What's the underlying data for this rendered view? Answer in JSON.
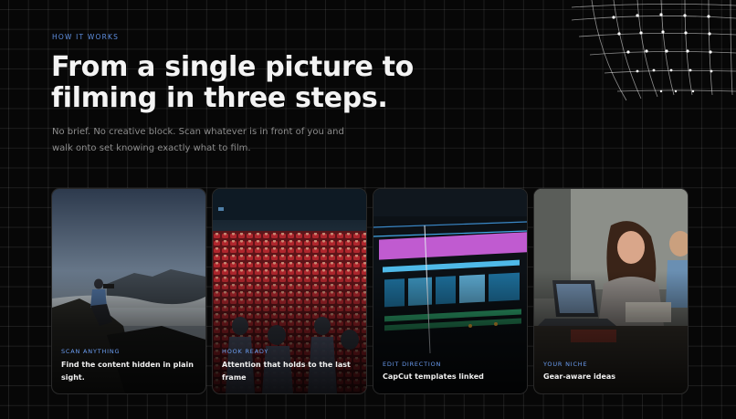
{
  "hero": {
    "eyebrow": "HOW IT WORKS",
    "headline": "From a single picture to filming in three steps.",
    "subtext": "No brief. No creative block. Scan whatever is in front of you and walk onto set knowing exactly what to film."
  },
  "cards": [
    {
      "tag": "SCAN ANYTHING",
      "title": "Find the content hidden in plain sight.",
      "image": "photographer-on-mountain"
    },
    {
      "tag": "HOOK READY",
      "title": "Attention that holds to the last frame",
      "image": "cinema-audience"
    },
    {
      "tag": "EDIT DIRECTION",
      "title": "CapCut templates linked",
      "image": "video-editing-timeline"
    },
    {
      "tag": "YOUR NICHE",
      "title": "Gear-aware ideas",
      "image": "creators-with-laptop"
    }
  ],
  "colors": {
    "background": "#070707",
    "accent": "#5f8fe0",
    "muted_text": "#8d8d8d"
  }
}
